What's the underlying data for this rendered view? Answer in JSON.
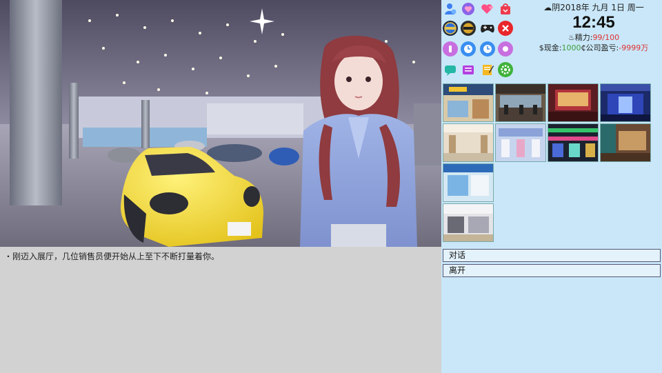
{
  "scene": {
    "message": "・刚迈入展厅，几位销售员便开始从上至下不断打量着你。"
  },
  "status": {
    "weather_icon": "cloud-icon",
    "date_text": "阴2018年 九月 1日 周一",
    "time": "12:45",
    "energy_label": "精力:",
    "energy_value": "99/100",
    "cash_label": "$现金:",
    "cash_value": "1000",
    "company_label": "₵公司盈亏:",
    "company_value": "-9999万"
  },
  "toolbar_icons": [
    "user-icon",
    "heart-ring-icon",
    "hearts-icon",
    "bag-icon",
    "badge-blue-icon",
    "badge-gold-icon",
    "gamepad-icon",
    "close-icon",
    "cosmetics-icon",
    "clock-icon",
    "clock-icon",
    "party-icon",
    "chat-icon",
    "tv-icon",
    "notepad-icon",
    "settings-icon"
  ],
  "locations": [
    "location-mall",
    "location-gym",
    "location-bar",
    "location-club",
    "location-lobby",
    "location-store",
    "location-arcade",
    "location-office",
    "location-shop",
    "location-atrium"
  ],
  "actions": {
    "talk": "对话",
    "leave": "离开"
  }
}
